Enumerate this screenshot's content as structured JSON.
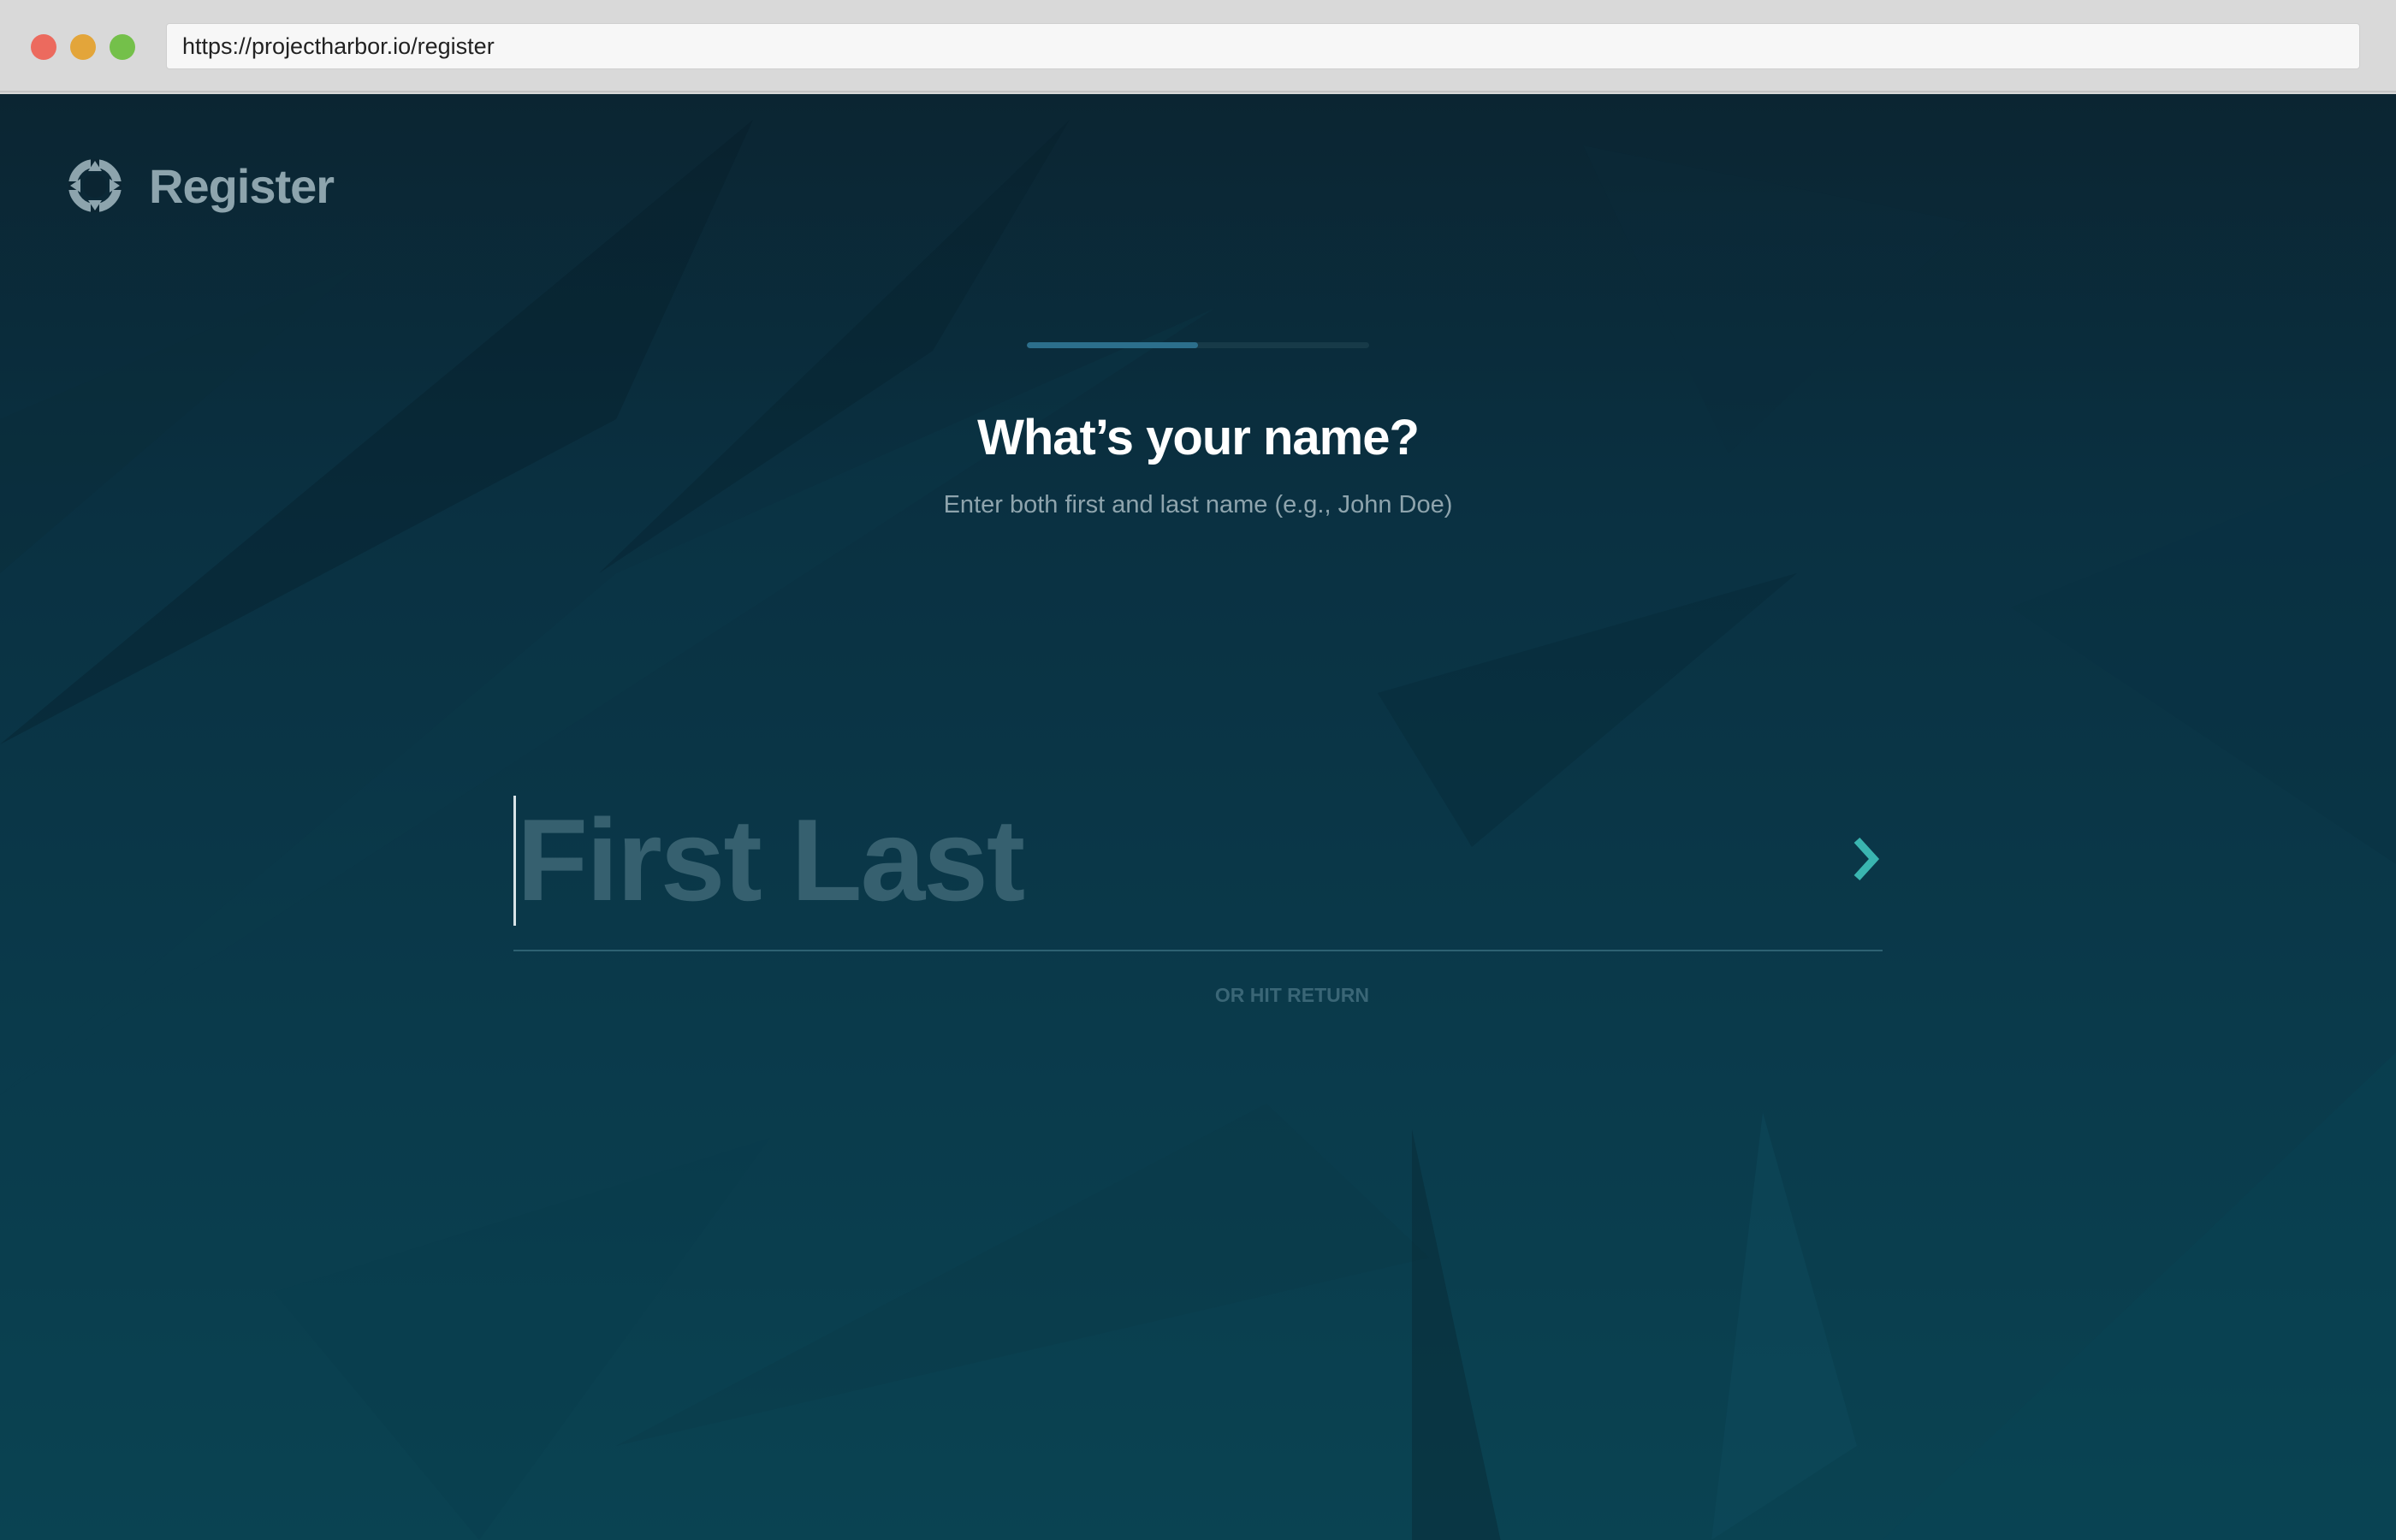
{
  "browser": {
    "url": "https://projectharbor.io/register"
  },
  "header": {
    "logo_icon": "lifebuoy-icon",
    "title": "Register"
  },
  "progress": {
    "fraction": 0.5,
    "fill_color": "#2c6f8c",
    "track_color": "#173a48"
  },
  "question": {
    "title": "What’s your name?",
    "hint": "Enter both first and last name (e.g., John Doe)"
  },
  "name_field": {
    "value": "",
    "placeholder": "First Last",
    "submit_icon": "chevron-right-icon",
    "submit_color": "#3ab5b0"
  },
  "return_hint": "OR HIT RETURN",
  "theme": {
    "background_top": "#0b2532",
    "background_bottom": "#0a4352",
    "heading_color": "#ffffff",
    "muted_text": "#8ea4ad"
  }
}
